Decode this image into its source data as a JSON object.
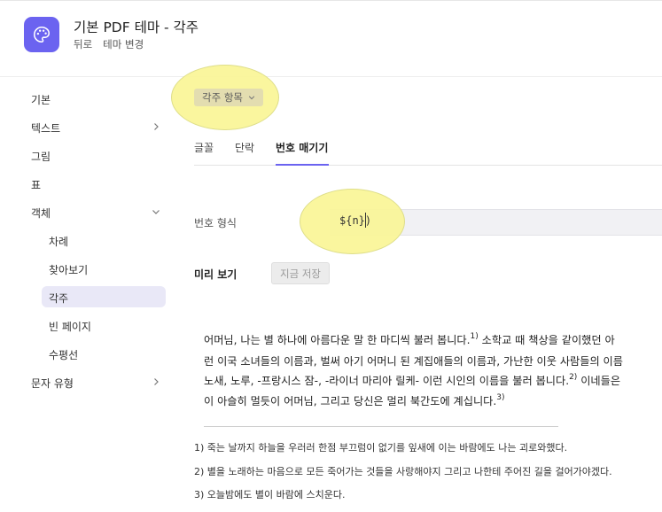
{
  "header": {
    "title": "기본 PDF 테마 - 각주",
    "breadcrumbs": [
      "뒤로",
      "테마 변경"
    ]
  },
  "sidebar": {
    "items": [
      {
        "label": "기본",
        "has_chevron": false
      },
      {
        "label": "텍스트",
        "has_chevron": "right"
      },
      {
        "label": "그림",
        "has_chevron": false
      },
      {
        "label": "표",
        "has_chevron": false
      },
      {
        "label": "객체",
        "has_chevron": "down"
      },
      {
        "label": "차례",
        "sub": true
      },
      {
        "label": "찾아보기",
        "sub": true
      },
      {
        "label": "각주",
        "sub": true,
        "active": true
      },
      {
        "label": "빈 페이지",
        "sub": true
      },
      {
        "label": "수평선",
        "sub": true
      },
      {
        "label": "문자 유형",
        "has_chevron": "right"
      }
    ]
  },
  "selector": {
    "label": "각주 항목"
  },
  "tabs": [
    {
      "label": "글꼴",
      "active": false
    },
    {
      "label": "단락",
      "active": false
    },
    {
      "label": "번호 매기기",
      "active": true
    }
  ],
  "number_format": {
    "label": "번호 형식",
    "value": "${n})"
  },
  "preview": {
    "label": "미리 보기",
    "save_button": "지금 저장",
    "paragraph_lines": [
      {
        "text": "어머님, 나는 별 하나에 아름다운 말 한 마디씩 불러 봅니다.",
        "sup": "1)",
        "tail": " 소학교 때 책상을 같이했던 아"
      },
      {
        "text": "런 이국 소녀들의 이름과, 벌써 아기 어머니 된 계집애들의 이름과, 가난한 이웃 사람들의 이름",
        "sup": "",
        "tail": ""
      },
      {
        "text": "노새, 노루, -프랑시스 잠-, -라이너 마리아 릴케- 이런 시인의 이름을 불러 봅니다.",
        "sup": "2)",
        "tail": " 이네들은"
      },
      {
        "text": "이 아슬히 멀듯이 어머님, 그리고 당신은 멀리 북간도에 계십니다.",
        "sup": "3)",
        "tail": ""
      }
    ],
    "footnotes": [
      "1) 죽는 날까지 하늘을 우러러 한점 부끄럼이 없기를 잎새에 이는 바람에도 나는 괴로와했다.",
      "2) 별을 노래하는 마음으로 모든 죽어가는 것들을 사랑해야지 그리고 나한테 주어진 길을 걸어가야겠다.",
      "3) 오늘밤에도 별이 바람에 스치운다."
    ]
  },
  "colors": {
    "accent": "#6b63f0",
    "highlight": "#faf596",
    "active_bg": "#e9e8f7"
  },
  "icons": {
    "app": "palette-icon",
    "dropdown": "chevron-down-icon",
    "expand": "chevron-right-icon",
    "collapse": "chevron-down-icon"
  }
}
